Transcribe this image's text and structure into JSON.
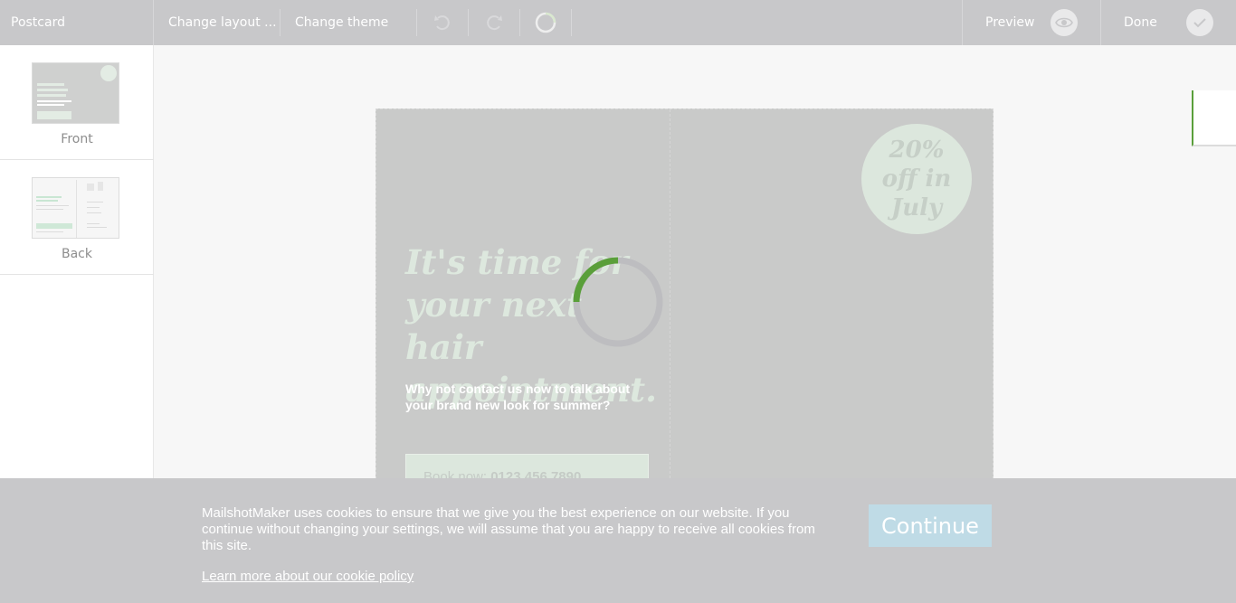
{
  "toolbar": {
    "title": "Postcard",
    "change_layout": "Change layout ...",
    "change_theme": "Change theme",
    "preview_label": "Preview",
    "done_label": "Done",
    "icons": [
      "undo-icon",
      "redo-icon",
      "loading-ring-icon",
      "eye-icon",
      "check-icon"
    ]
  },
  "sidebar": {
    "pages": [
      {
        "label": "Front"
      },
      {
        "label": "Back"
      }
    ]
  },
  "postcard": {
    "badge_lines": [
      "20%",
      "off in",
      "July"
    ],
    "headline_lines": [
      "It's time for",
      "your next hair",
      "appointment."
    ],
    "subtext": "Why not contact us now to talk about your brand new look for summer?",
    "book_prefix": "Book now:",
    "book_phone": "0123 456 7890"
  },
  "cookie_banner": {
    "text": "MailshotMaker uses cookies to ensure that we give you the best experience on our website. If you continue without changing your settings, we will assume that you are happy to receive all cookies from this site.",
    "link": "Learn more about our cookie policy",
    "button": "Continue"
  },
  "colors": {
    "accent_green": "#5a9f3a",
    "toolbar_bg": "#c8c8ca",
    "badge_bg": "#dce7dd",
    "continue_bg": "#bfdbe6"
  }
}
